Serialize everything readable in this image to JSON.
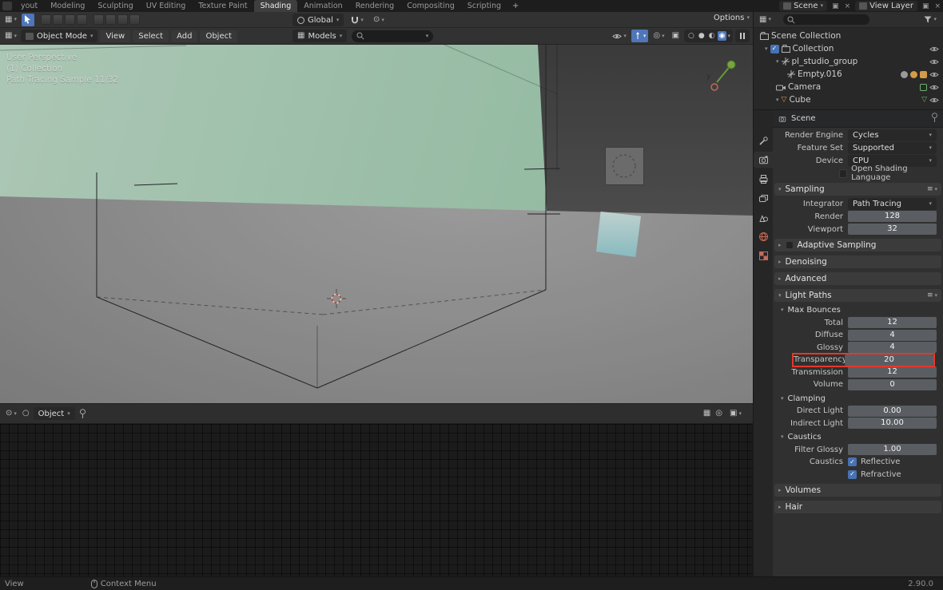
{
  "colors": {
    "accent_blue": "#4772b3",
    "annotation_red": "#e5372b",
    "wall_green": "#b6dfc5",
    "floor_gray": "#a6a6a6",
    "back_wall_gray": "#5c5c5c"
  },
  "glyphs": {
    "caret_down": "▾",
    "caret_right": "▸",
    "check": "✓",
    "plus": "+",
    "close": "×",
    "menu_lines": "≡",
    "grid": "▦",
    "prop_circle": "⊙",
    "overlays": "◎",
    "square_dot": "▣",
    "circle_open": "○",
    "circle": "●",
    "circle_half": "◐",
    "circle_dot": "◉",
    "tri_down": "▽"
  },
  "topbar": {
    "tabs": [
      {
        "label": "yout"
      },
      {
        "label": "Modeling"
      },
      {
        "label": "Sculpting"
      },
      {
        "label": "UV Editing"
      },
      {
        "label": "Texture Paint"
      },
      {
        "label": "Shading"
      },
      {
        "label": "Animation"
      },
      {
        "label": "Rendering"
      },
      {
        "label": "Compositing"
      },
      {
        "label": "Scripting"
      }
    ],
    "active_tab": "Shading",
    "scene": {
      "label": "Scene"
    },
    "view_layer": {
      "label": "View Layer"
    }
  },
  "tool_settings": {
    "orientation": "Global",
    "options": "Options"
  },
  "viewport": {
    "mode": "Object Mode",
    "menus": [
      "View",
      "Select",
      "Add",
      "Object"
    ],
    "asset_dropdown": "Models",
    "overlay": {
      "line1": "User Perspective",
      "line2": "(1) Collection",
      "line3": "Path Tracing Sample 11/32"
    },
    "gizmo_axis_label": "y"
  },
  "outliner": {
    "items": [
      {
        "label": "Scene Collection"
      },
      {
        "label": "Collection"
      },
      {
        "label": "pl_studio_group"
      },
      {
        "label": "Empty.016"
      },
      {
        "label": "Camera"
      },
      {
        "label": "Cube"
      }
    ]
  },
  "properties": {
    "breadcrumb": "Scene",
    "render_engine": {
      "label": "Render Engine",
      "value": "Cycles"
    },
    "feature_set": {
      "label": "Feature Set",
      "value": "Supported"
    },
    "device": {
      "label": "Device",
      "value": "CPU"
    },
    "osl": {
      "label": "Open Shading Language"
    },
    "sampling": {
      "title": "Sampling",
      "integrator": {
        "label": "Integrator",
        "value": "Path Tracing"
      },
      "render": {
        "label": "Render",
        "value": "128"
      },
      "viewport": {
        "label": "Viewport",
        "value": "32"
      }
    },
    "adaptive_sampling": "Adaptive Sampling",
    "denoising": "Denoising",
    "advanced": "Advanced",
    "light_paths": {
      "title": "Light Paths",
      "max_bounces": {
        "title": "Max Bounces",
        "total": {
          "label": "Total",
          "value": "12"
        },
        "diffuse": {
          "label": "Diffuse",
          "value": "4"
        },
        "glossy": {
          "label": "Glossy",
          "value": "4"
        },
        "transparency": {
          "label": "Transparency",
          "value": "20"
        },
        "transmission": {
          "label": "Transmission",
          "value": "12"
        },
        "volume": {
          "label": "Volume",
          "value": "0"
        }
      },
      "clamping": {
        "title": "Clamping",
        "direct_light": {
          "label": "Direct Light",
          "value": "0.00"
        },
        "indirect_light": {
          "label": "Indirect Light",
          "value": "10.00"
        }
      },
      "caustics": {
        "title": "Caustics",
        "filter_glossy": {
          "label": "Filter Glossy",
          "value": "1.00"
        },
        "caustics_label": "Caustics",
        "reflective": "Reflective",
        "refractive": "Refractive"
      }
    },
    "volumes": "Volumes",
    "hair": "Hair"
  },
  "shader_editor": {
    "shader_type": "Object"
  },
  "statusbar": {
    "left_hint": "View",
    "context_hint": "Context Menu",
    "version": "2.90.0"
  }
}
